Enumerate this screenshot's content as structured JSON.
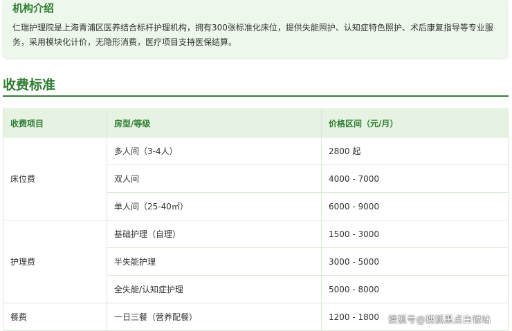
{
  "intro": {
    "title": "机构介绍",
    "text": "仁瑞护理院是上海青浦区医养结合标杆护理机构，拥有300张标准化床位，提供失能照护、认知症特色照护、术后康复指导等专业服务，采用模块化计价，无隐形消费，医疗项目支持医保结算。"
  },
  "fees": {
    "title": "收费标准",
    "headers": [
      "收费项目",
      "房型/等级",
      "价格区间（元/月）"
    ],
    "groups": [
      {
        "category": "床位费",
        "rows": [
          {
            "level": "多人间（3-4人）",
            "price": "2800 起"
          },
          {
            "level": "双人间",
            "price": "4000 - 7000"
          },
          {
            "level": "单人间（25-40㎡）",
            "price": "6000 - 9000"
          }
        ]
      },
      {
        "category": "护理费",
        "rows": [
          {
            "level": "基础护理（自理）",
            "price": "1500 - 3000"
          },
          {
            "level": "半失能护理",
            "price": "3000 - 5000"
          },
          {
            "level": "全失能/认知症护理",
            "price": "5000 - 8000"
          }
        ]
      },
      {
        "category": "餐费",
        "rows": [
          {
            "level": "一日三餐（营养配餐）",
            "price": "1200 - 1800"
          }
        ]
      }
    ]
  },
  "watermark": "搜狐号@搜狐黑点白银站"
}
